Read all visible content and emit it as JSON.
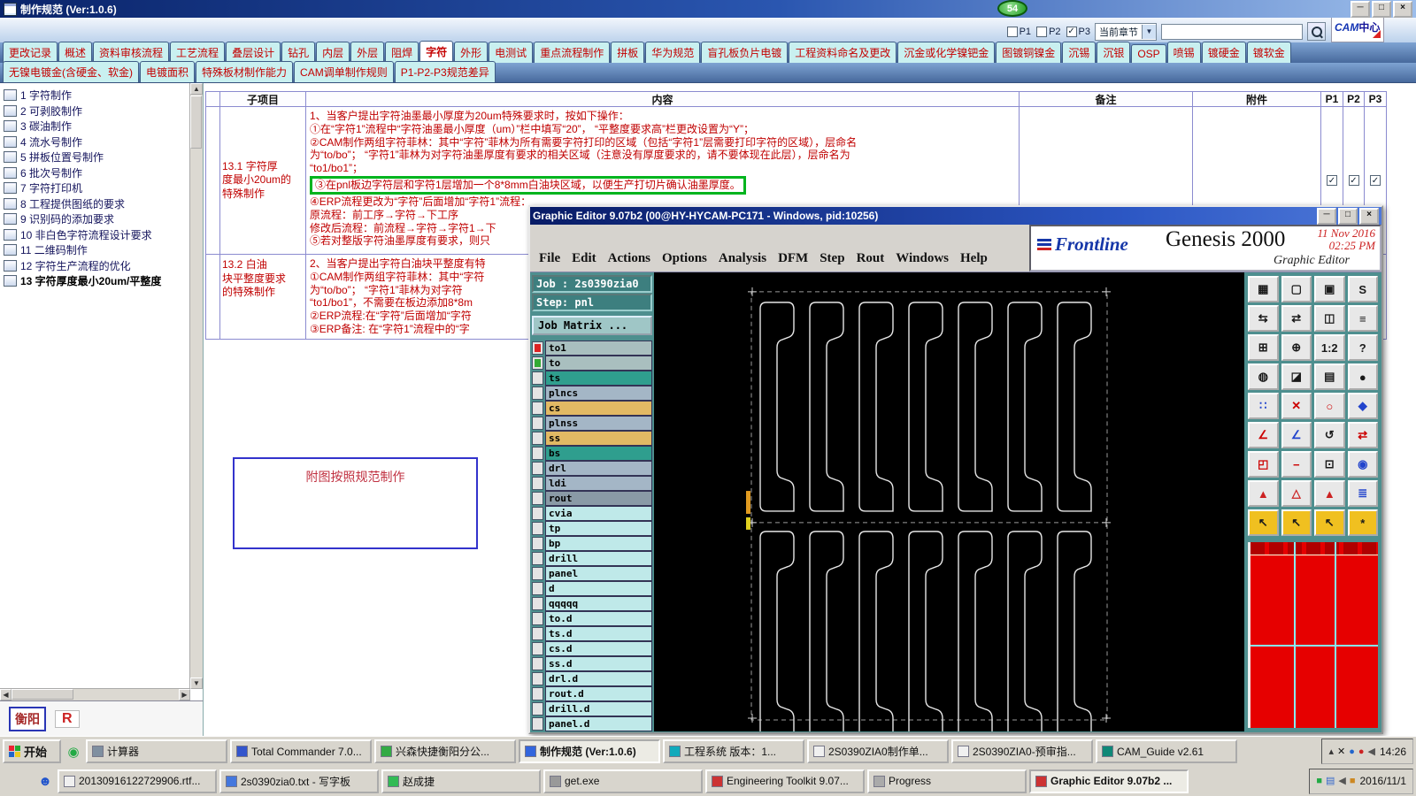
{
  "app": {
    "title": "制作规范 (Ver:1.0.6)",
    "badge": "54",
    "win_buttons": {
      "min": "─",
      "max": "□",
      "close": "×"
    },
    "logo": {
      "main": "CAM",
      "sub": "中心"
    },
    "topbar": {
      "page_checks": [
        {
          "label": "P1",
          "on": false
        },
        {
          "label": "P2",
          "on": false
        },
        {
          "label": "P3",
          "on": true
        }
      ],
      "chapter": "当前章节",
      "search_value": ""
    },
    "tabs_row1": [
      {
        "label": "更改记录"
      },
      {
        "label": "概述"
      },
      {
        "label": "资料审核流程"
      },
      {
        "label": "工艺流程"
      },
      {
        "label": "叠层设计"
      },
      {
        "label": "钻孔"
      },
      {
        "label": "内层"
      },
      {
        "label": "外层"
      },
      {
        "label": "阻焊"
      },
      {
        "label": "字符",
        "active": true
      },
      {
        "label": "外形"
      },
      {
        "label": "电测试"
      },
      {
        "label": "重点流程制作"
      },
      {
        "label": "拼板"
      },
      {
        "label": "华为规范"
      },
      {
        "label": "盲孔板负片电镀"
      },
      {
        "label": "工程资料命名及更改"
      },
      {
        "label": "沉金或化学镍钯金"
      },
      {
        "label": "图镀铜镍金"
      },
      {
        "label": "沉锡"
      },
      {
        "label": "沉银"
      },
      {
        "label": "OSP"
      },
      {
        "label": "喷锡"
      },
      {
        "label": "镀硬金"
      },
      {
        "label": "镀软金"
      }
    ],
    "tabs_row2": [
      {
        "label": "无镍电镀金(含硬金、软金)"
      },
      {
        "label": "电镀面积"
      },
      {
        "label": "特殊板材制作能力"
      },
      {
        "label": "CAM调单制作规则"
      },
      {
        "label": "P1-P2-P3规范差异"
      }
    ]
  },
  "tree": {
    "items": [
      {
        "label": "1 字符制作"
      },
      {
        "label": "2 可剥胶制作"
      },
      {
        "label": "3 碳油制作"
      },
      {
        "label": "4 流水号制作"
      },
      {
        "label": "5 拼板位置号制作"
      },
      {
        "label": "6 批次号制作"
      },
      {
        "label": "7 字符打印机"
      },
      {
        "label": "8 工程提供图纸的要求"
      },
      {
        "label": "9 识别码的添加要求"
      },
      {
        "label": "10 非白色字符流程设计要求"
      },
      {
        "label": "11 二维码制作"
      },
      {
        "label": "12 字符生产流程的优化"
      },
      {
        "label": "13 字符厚度最小20um/平整度",
        "selected": true
      }
    ],
    "footer": {
      "left": "衡阳",
      "right": "R"
    }
  },
  "table": {
    "headers": {
      "sub": "子项目",
      "content": "内容",
      "remark": "备注",
      "attach": "附件",
      "p1": "P1",
      "p2": "P2",
      "p3": "P3"
    },
    "row1": {
      "label_lines": [
        {
          "t": "13.1 字符厚"
        },
        {
          "t": "度最小20um的"
        },
        {
          "t": "特殊制作"
        }
      ],
      "lines": [
        {
          "t": "1、当客户提出字符油墨最小厚度为20um特殊要求时，按如下操作："
        },
        {
          "t": "①在“字符1”流程中“字符油墨最小厚度（um）”栏中填写“20”， “平整度要求高”栏更改设置为“Y”；"
        },
        {
          "t": "②CAM制作两组字符菲林：其中“字符”菲林为所有需要字符打印的区域（包括“字符1”层需要打印字符的区域），层命名"
        },
        {
          "t": "为“to/bo”； “字符1”菲林为对字符油墨厚度有要求的相关区域（注意没有厚度要求的，请不要体现在此层），层命名为"
        },
        {
          "t": "“to1/bo1”；"
        },
        {
          "t": "③在pnl板边字符层和字符1层增加一个8*8mm白油块区域，以便生产打切片确认油墨厚度。",
          "hl": true
        },
        {
          "t": "④ERP流程更改为“字符”后面增加“字符1”流程："
        },
        {
          "t": "原流程：前工序→字符→下工序"
        },
        {
          "t": "修改后流程：前流程→字符→字符1→下"
        },
        {
          "t": "⑤若对整版字符油墨厚度有要求，则只"
        }
      ],
      "checks": [
        {
          "on": true
        },
        {
          "on": true
        },
        {
          "on": true
        }
      ]
    },
    "row2": {
      "label_lines": [
        {
          "t": "13.2  白油"
        },
        {
          "t": "块平整度要求"
        },
        {
          "t": "的特殊制作"
        }
      ],
      "lines": [
        {
          "t": "2、当客户提出字符白油块平整度有特"
        },
        {
          "t": "①CAM制作两组字符菲林：其中“字符"
        },
        {
          "t": "为“to/bo”； “字符1”菲林为对字符"
        },
        {
          "t": "“to1/bo1”，不需要在板边添加8*8m"
        },
        {
          "t": "②ERP流程:在“字符”后面增加“字符"
        },
        {
          "t": "③ERP备注: 在“字符1”流程中的“字"
        }
      ]
    },
    "figure_note": "附图按照规范制作"
  },
  "editor": {
    "title": "Graphic Editor 9.07b2 (00@HY-HYCAM-PC171 - Windows, pid:10256)",
    "win_buttons": {
      "min": "─",
      "max": "□",
      "close": "×"
    },
    "menu": [
      "File",
      "Edit",
      "Actions",
      "Options",
      "Analysis",
      "DFM",
      "Step",
      "Rout",
      "Windows",
      "Help"
    ],
    "brand": {
      "name": "Frontline",
      "product": "Genesis 2000",
      "date": "11 Nov 2016",
      "time": "02:25 PM",
      "subtitle": "Graphic Editor"
    },
    "job": "Job : 2s0390zia0",
    "step": "Step: pnl",
    "matrix": "Job Matrix ...",
    "layers": [
      {
        "name": "to1",
        "bg": "#a9bfbf",
        "box": "#dd2222"
      },
      {
        "name": "to",
        "bg": "#a9bfbf",
        "box": "#33aa33"
      },
      {
        "name": "ts",
        "bg": "#2f9e8e"
      },
      {
        "name": "plncs",
        "bg": "#a4b6c6"
      },
      {
        "name": "cs",
        "bg": "#e2b964"
      },
      {
        "name": "plnss",
        "bg": "#a4b6c6"
      },
      {
        "name": "ss",
        "bg": "#e2b964"
      },
      {
        "name": "bs",
        "bg": "#2f9e8e"
      },
      {
        "name": "drl",
        "bg": "#a4b6c6"
      },
      {
        "name": "ldi",
        "bg": "#a4b6c6"
      },
      {
        "name": "rout",
        "bg": "#8a9aa6"
      },
      {
        "name": "cvia",
        "bg": "#bfe9e9"
      },
      {
        "name": "tp",
        "bg": "#bfe9e9"
      },
      {
        "name": "bp",
        "bg": "#bfe9e9"
      },
      {
        "name": "drill",
        "bg": "#bfe9e9"
      },
      {
        "name": "panel",
        "bg": "#bfe9e9"
      },
      {
        "name": "d",
        "bg": "#bfe9e9"
      },
      {
        "name": "qqqqq",
        "bg": "#bfe9e9"
      },
      {
        "name": "to.d",
        "bg": "#bfe9e9"
      },
      {
        "name": "ts.d",
        "bg": "#bfe9e9"
      },
      {
        "name": "cs.d",
        "bg": "#bfe9e9"
      },
      {
        "name": "ss.d",
        "bg": "#bfe9e9"
      },
      {
        "name": "drl.d",
        "bg": "#bfe9e9"
      },
      {
        "name": "rout.d",
        "bg": "#bfe9e9"
      },
      {
        "name": "drill.d",
        "bg": "#bfe9e9"
      },
      {
        "name": "panel.d",
        "bg": "#bfe9e9"
      }
    ],
    "tools": [
      {
        "name": "panel-icon",
        "glyph": "▦"
      },
      {
        "name": "display-icon",
        "glyph": "▢"
      },
      {
        "name": "film-icon",
        "glyph": "▣"
      },
      {
        "name": "s-tool-icon",
        "glyph": "S"
      },
      {
        "name": "swap-left-icon",
        "glyph": "⇆"
      },
      {
        "name": "swap-right-icon",
        "glyph": "⇄"
      },
      {
        "name": "split-view-icon",
        "glyph": "◫"
      },
      {
        "name": "list-icon",
        "glyph": "≡"
      },
      {
        "name": "grid-plus-icon",
        "glyph": "⊞"
      },
      {
        "name": "target-icon",
        "glyph": "⊕"
      },
      {
        "name": "scale-1to2-icon",
        "glyph": "1:2"
      },
      {
        "name": "help-icon",
        "glyph": "?"
      },
      {
        "name": "shade-icon",
        "glyph": "◍"
      },
      {
        "name": "corner-fill-icon",
        "glyph": "◪"
      },
      {
        "name": "ruler-icon",
        "glyph": "▤"
      },
      {
        "name": "dot-icon",
        "glyph": "●"
      },
      {
        "name": "points-icon",
        "glyph": "∷",
        "fg": "#2244cc"
      },
      {
        "name": "delete-x-icon",
        "glyph": "✕",
        "fg": "#cc0000"
      },
      {
        "name": "circle-icon",
        "glyph": "○",
        "fg": "#cc0000"
      },
      {
        "name": "diamond-icon",
        "glyph": "◆",
        "fg": "#2244cc"
      },
      {
        "name": "angle-red-icon",
        "glyph": "∠",
        "fg": "#cc0000"
      },
      {
        "name": "angle-blue-icon",
        "glyph": "∠",
        "fg": "#2244cc"
      },
      {
        "name": "undo-icon",
        "glyph": "↺"
      },
      {
        "name": "reverse-icon",
        "glyph": "⇄",
        "fg": "#cc0000"
      },
      {
        "name": "frame-icon",
        "glyph": "◰",
        "fg": "#cc0000"
      },
      {
        "name": "minus-red-icon",
        "glyph": "−",
        "fg": "#cc0000"
      },
      {
        "name": "box-dot-icon",
        "glyph": "⊡"
      },
      {
        "name": "bullseye-icon",
        "glyph": "◉",
        "fg": "#2244cc"
      },
      {
        "name": "warning-red-icon",
        "glyph": "▲",
        "fg": "#cc2222"
      },
      {
        "name": "warning-outline-icon",
        "glyph": "△",
        "fg": "#cc2222"
      },
      {
        "name": "warning-up-icon",
        "glyph": "▲",
        "fg": "#cc2222"
      },
      {
        "name": "doc-lines-icon",
        "glyph": "≣",
        "fg": "#2244cc"
      },
      {
        "name": "cursor-yellow-icon",
        "glyph": "↖",
        "bg": "#f0c020"
      },
      {
        "name": "cursor2-yellow-icon",
        "glyph": "↖",
        "bg": "#f0c020"
      },
      {
        "name": "cursor3-yellow-icon",
        "glyph": "↖",
        "bg": "#f0c020"
      },
      {
        "name": "settings-icon",
        "glyph": "*",
        "bg": "#f0c020"
      }
    ]
  },
  "taskbar": {
    "start": "开始",
    "row1": [
      {
        "label": "计算器",
        "icon": "#7f8fa0"
      },
      {
        "label": "Total Commander 7.0...",
        "icon": "#3355cc"
      },
      {
        "label": "兴森快捷衡阳分公...",
        "icon": "#33aa44"
      },
      {
        "label": "制作规范 (Ver:1.0.6)",
        "icon": "#3366dd",
        "active": true
      },
      {
        "label": "工程系统 版本：1...",
        "icon": "#11aabb"
      },
      {
        "label": "2S0390ZIA0制作单...",
        "icon": "#f0f0f0"
      },
      {
        "label": "2S0390ZIA0-预审指...",
        "icon": "#f0f0f0"
      },
      {
        "label": "CAM_Guide v2.61",
        "icon": "#0f8877"
      }
    ],
    "row2": [
      {
        "label": "20130916122729906.rtf...",
        "icon": "#f0f0f0"
      },
      {
        "label": "2s0390zia0.txt - 写字板",
        "icon": "#4477dd"
      },
      {
        "label": "赵成捷",
        "icon": "#33bb55"
      },
      {
        "label": "get.exe",
        "icon": "#999999"
      },
      {
        "label": "Engineering Toolkit 9.07...",
        "icon": "#cc3333"
      },
      {
        "label": "Progress",
        "icon": "#aaaaaa"
      },
      {
        "label": "Graphic Editor 9.07b2 ...",
        "icon": "#cc3333",
        "active": true
      }
    ],
    "tray1": [
      {
        "name": "expand-tray-icon",
        "glyph": "▴",
        "color": "#333"
      },
      {
        "name": "cut-tray-icon",
        "glyph": "✕",
        "color": "#111"
      },
      {
        "name": "blue-app-tray-icon",
        "glyph": "●",
        "color": "#2266cc"
      },
      {
        "name": "red-app-tray-icon",
        "glyph": "●",
        "color": "#cc2222"
      },
      {
        "name": "volume-tray-icon",
        "glyph": "◀",
        "color": "#555"
      }
    ],
    "tray2": [
      {
        "name": "green-app-tray-icon",
        "glyph": "■",
        "color": "#22aa44"
      },
      {
        "name": "network-tray-icon",
        "glyph": "▤",
        "color": "#3366cc"
      },
      {
        "name": "volume2-tray-icon",
        "glyph": "◀",
        "color": "#555"
      },
      {
        "name": "orange-app-tray-icon",
        "glyph": "■",
        "color": "#cc8822"
      }
    ],
    "time": "14:26",
    "date": "2016/11/1"
  }
}
